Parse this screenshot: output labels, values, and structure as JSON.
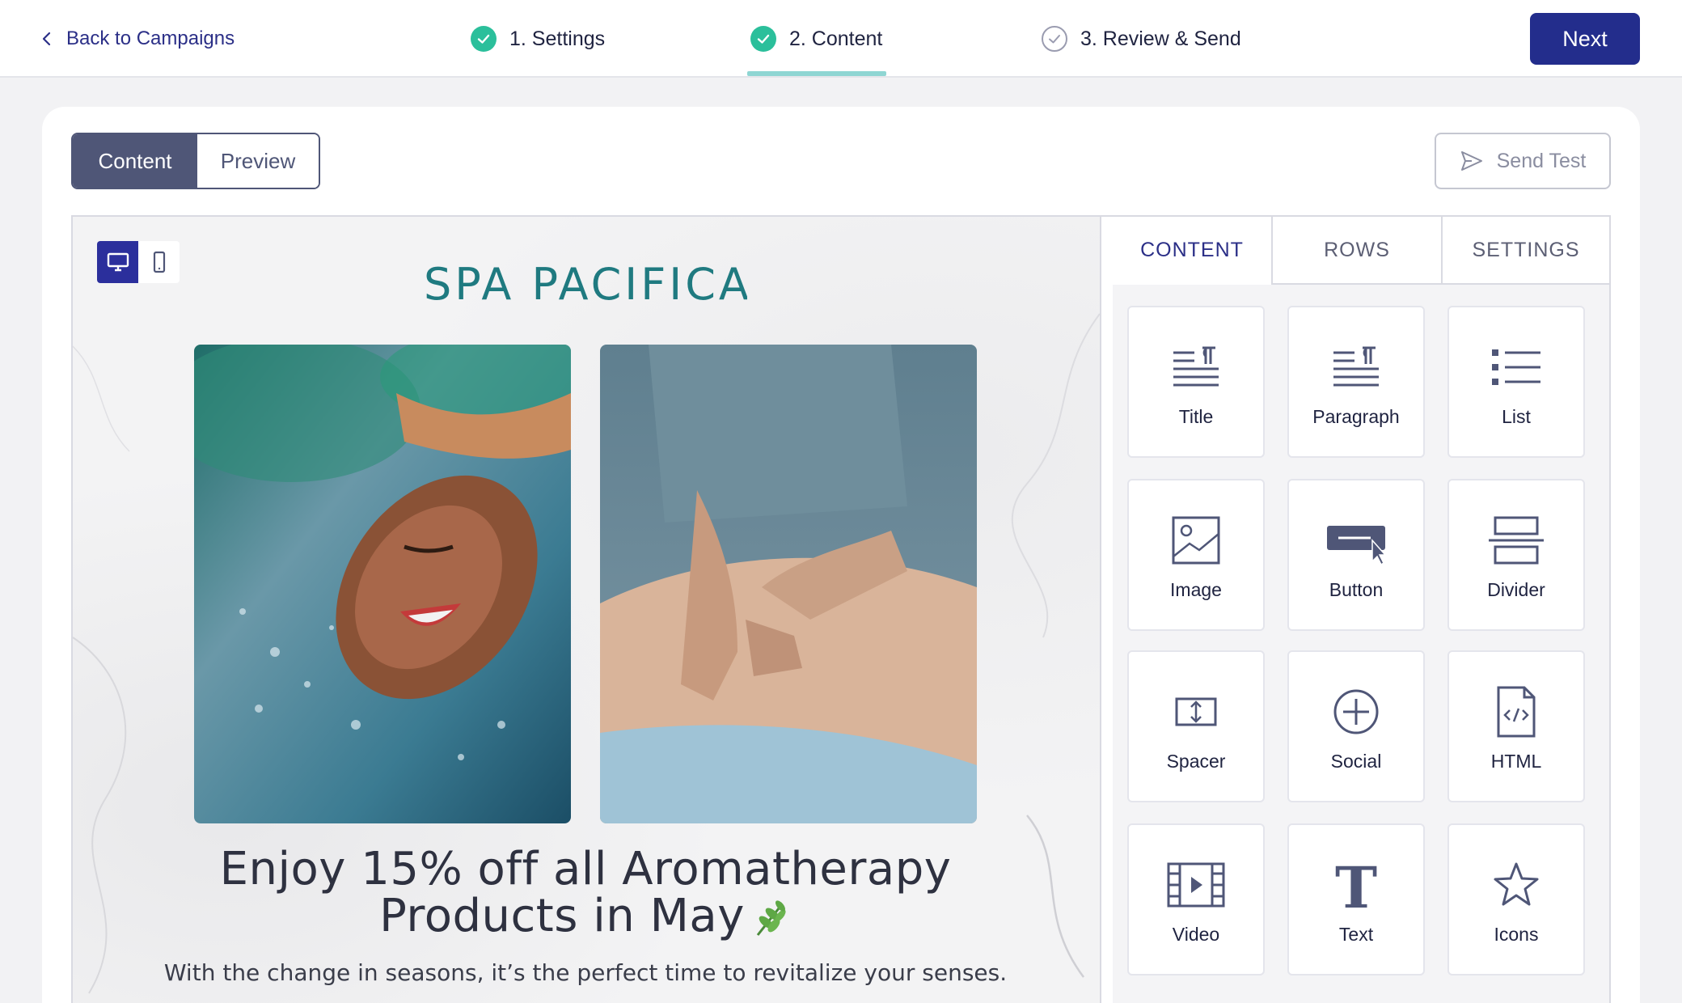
{
  "topbar": {
    "back_label": "Back to Campaigns",
    "steps": [
      {
        "label": "1. Settings",
        "status": "done"
      },
      {
        "label": "2. Content",
        "status": "done",
        "active": true
      },
      {
        "label": "3. Review & Send",
        "status": "todo"
      }
    ],
    "next_label": "Next"
  },
  "editor": {
    "view_toggle": {
      "content_label": "Content",
      "preview_label": "Preview",
      "selected": "Content"
    },
    "send_test_label": "Send Test",
    "device": {
      "selected": "desktop"
    }
  },
  "email": {
    "logo_text": "SPA PACIFICA",
    "headline_line1": "Enjoy 15% off all Aromatherapy",
    "headline_line2": "Products in May",
    "subline": "With the change in seasons, it’s the perfect time to revitalize your senses."
  },
  "panel": {
    "tabs": [
      {
        "label": "CONTENT",
        "active": true
      },
      {
        "label": "ROWS"
      },
      {
        "label": "SETTINGS"
      }
    ],
    "blocks": [
      {
        "label": "Title",
        "icon": "title-icon"
      },
      {
        "label": "Paragraph",
        "icon": "paragraph-icon"
      },
      {
        "label": "List",
        "icon": "list-icon"
      },
      {
        "label": "Image",
        "icon": "image-icon"
      },
      {
        "label": "Button",
        "icon": "button-icon"
      },
      {
        "label": "Divider",
        "icon": "divider-icon"
      },
      {
        "label": "Spacer",
        "icon": "spacer-icon"
      },
      {
        "label": "Social",
        "icon": "social-icon"
      },
      {
        "label": "HTML",
        "icon": "html-icon"
      },
      {
        "label": "Video",
        "icon": "video-icon"
      },
      {
        "label": "Text",
        "icon": "text-icon"
      },
      {
        "label": "Icons",
        "icon": "star-icon"
      }
    ]
  },
  "colors": {
    "primary": "#232d8c",
    "success": "#2bbf9b",
    "accent_underline": "#8fd6d3",
    "logo": "#1f7a80",
    "icon": "#4f5677"
  }
}
